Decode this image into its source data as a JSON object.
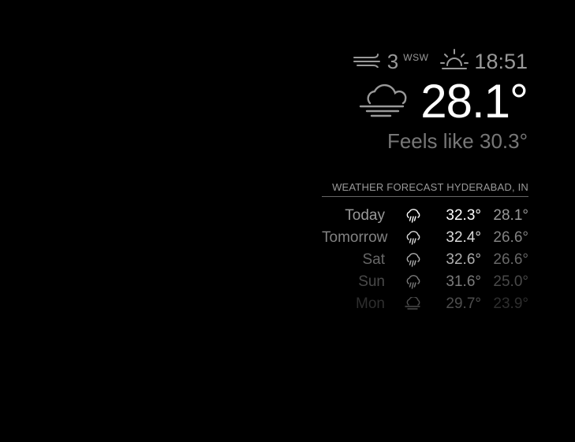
{
  "current": {
    "wind_icon": "wind-icon",
    "wind_speed": "3",
    "wind_direction": "WSW",
    "sun_icon": "sunset-icon",
    "sun_time": "18:51",
    "condition_icon": "cloudy-fog-icon",
    "temperature": "28.1°",
    "feels_like": "Feels like 30.3°"
  },
  "forecast": {
    "header": "WEATHER FORECAST HYDERABAD, IN",
    "days": [
      {
        "day": "Today",
        "icon": "rain-cloud-icon",
        "max": "32.3°",
        "min": "28.1°",
        "opacity": 1.0
      },
      {
        "day": "Tomorrow",
        "icon": "rain-cloud-icon",
        "max": "32.4°",
        "min": "26.6°",
        "opacity": 0.85
      },
      {
        "day": "Sat",
        "icon": "rain-cloud-icon",
        "max": "32.6°",
        "min": "26.6°",
        "opacity": 0.68
      },
      {
        "day": "Sun",
        "icon": "rain-cloud-icon",
        "max": "31.6°",
        "min": "25.0°",
        "opacity": 0.48
      },
      {
        "day": "Mon",
        "icon": "cloudy-fog-icon",
        "max": "29.7°",
        "min": "23.9°",
        "opacity": 0.3
      }
    ]
  },
  "colors": {
    "background": "#000000",
    "primary_text": "#ffffff",
    "secondary_text": "#999999",
    "dim_text": "#777777",
    "divider": "#666666"
  }
}
